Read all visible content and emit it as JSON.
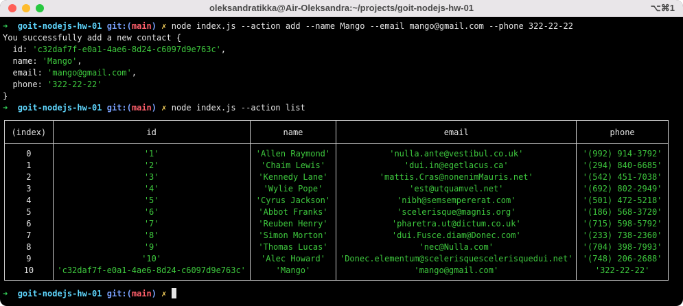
{
  "window": {
    "title": "oleksandratikka@Air-Oleksandra:~/projects/goit-nodejs-hw-01",
    "shortcut": "⌥⌘1"
  },
  "prompt": {
    "arrow": "➜",
    "dir": "goit-nodejs-hw-01",
    "git": "git:(",
    "branch": "main",
    "git_close": ")",
    "x": "✗"
  },
  "commands": {
    "add": "node index.js --action add --name Mango --email mango@gmail.com --phone 322-22-22",
    "list": "node index.js --action list"
  },
  "output": {
    "success": "You successfully add a new contact {",
    "fields": [
      {
        "key": "  id: ",
        "value": "'c32daf7f-e0a1-4ae6-8d24-c6097d9e763c'",
        "suffix": ","
      },
      {
        "key": "  name: ",
        "value": "'Mango'",
        "suffix": ","
      },
      {
        "key": "  email: ",
        "value": "'mango@gmail.com'",
        "suffix": ","
      },
      {
        "key": "  phone: ",
        "value": "'322-22-22'",
        "suffix": ""
      }
    ],
    "close": "}"
  },
  "table": {
    "headers": [
      "(index)",
      "id",
      "name",
      "email",
      "phone"
    ],
    "rows": [
      [
        "0",
        "'1'",
        "'Allen Raymond'",
        "'nulla.ante@vestibul.co.uk'",
        "'(992) 914-3792'"
      ],
      [
        "1",
        "'2'",
        "'Chaim Lewis'",
        "'dui.in@egetlacus.ca'",
        "'(294) 840-6685'"
      ],
      [
        "2",
        "'3'",
        "'Kennedy Lane'",
        "'mattis.Cras@nonenimMauris.net'",
        "'(542) 451-7038'"
      ],
      [
        "3",
        "'4'",
        "'Wylie Pope'",
        "'est@utquamvel.net'",
        "'(692) 802-2949'"
      ],
      [
        "4",
        "'5'",
        "'Cyrus Jackson'",
        "'nibh@semsempererat.com'",
        "'(501) 472-5218'"
      ],
      [
        "5",
        "'6'",
        "'Abbot Franks'",
        "'scelerisque@magnis.org'",
        "'(186) 568-3720'"
      ],
      [
        "6",
        "'7'",
        "'Reuben Henry'",
        "'pharetra.ut@dictum.co.uk'",
        "'(715) 598-5792'"
      ],
      [
        "7",
        "'8'",
        "'Simon Morton'",
        "'dui.Fusce.diam@Donec.com'",
        "'(233) 738-2360'"
      ],
      [
        "8",
        "'9'",
        "'Thomas Lucas'",
        "'nec@Nulla.com'",
        "'(704) 398-7993'"
      ],
      [
        "9",
        "'10'",
        "'Alec Howard'",
        "'Donec.elementum@scelerisquescelerisquedui.net'",
        "'(748) 206-2688'"
      ],
      [
        "10",
        "'c32daf7f-e0a1-4ae6-8d24-c6097d9e763c'",
        "'Mango'",
        "'mango@gmail.com'",
        "'322-22-22'"
      ]
    ]
  }
}
